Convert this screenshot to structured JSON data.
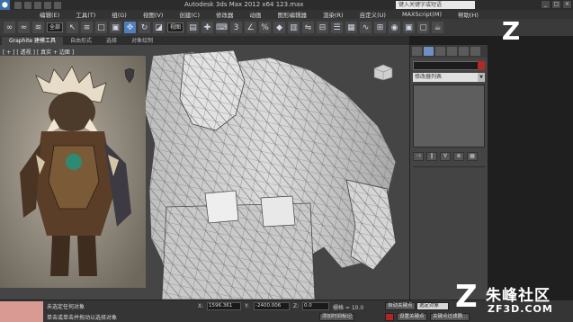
{
  "window": {
    "title": "Autodesk 3ds Max  2012 x64     123.max",
    "search_placeholder": "键入关键字或短语",
    "controls": [
      "_",
      "□",
      "×"
    ]
  },
  "menu": {
    "items": [
      "编辑(E)",
      "工具(T)",
      "组(G)",
      "视图(V)",
      "创建(C)",
      "修改器",
      "动画",
      "图形编辑器",
      "渲染(R)",
      "自定义(U)",
      "MAXScript(M)",
      "帮助(H)"
    ]
  },
  "toolbar": {
    "filter_select": "全部",
    "view_select": "视图"
  },
  "ribbon": {
    "tabs": [
      "Graphite 建模工具",
      "自由形式",
      "选择",
      "对象绘制"
    ]
  },
  "viewport": {
    "label": "[ + ] [ 透视 ] [ 真实 + 边面 ]",
    "mesh_color": "#d0d0d0",
    "background_color": "#454545"
  },
  "command_panel": {
    "object_name": "",
    "modifier_list": "修改器列表",
    "stack_buttons": [
      "⊣",
      "‖",
      "∀",
      "⊗",
      "▦"
    ]
  },
  "status": {
    "line1": "未选定任何对象",
    "line2": "单击或单击并拖动以选择对象",
    "x_label": "X:",
    "x_value": "1596.361",
    "y_label": "Y:",
    "y_value": "-2400.006",
    "z_label": "Z:",
    "z_value": "0.0",
    "grid_label": "栅格 = 10.0",
    "add_time_tag": "添加时间标记",
    "auto_key": "自动关键点",
    "set_key": "设置关键点",
    "selected_object": "选定对象",
    "key_filters": "关键点过滤器..."
  },
  "watermark": {
    "logo_letter": "Z",
    "chinese": "朱峰社区",
    "english": "ZF3D.COM"
  }
}
